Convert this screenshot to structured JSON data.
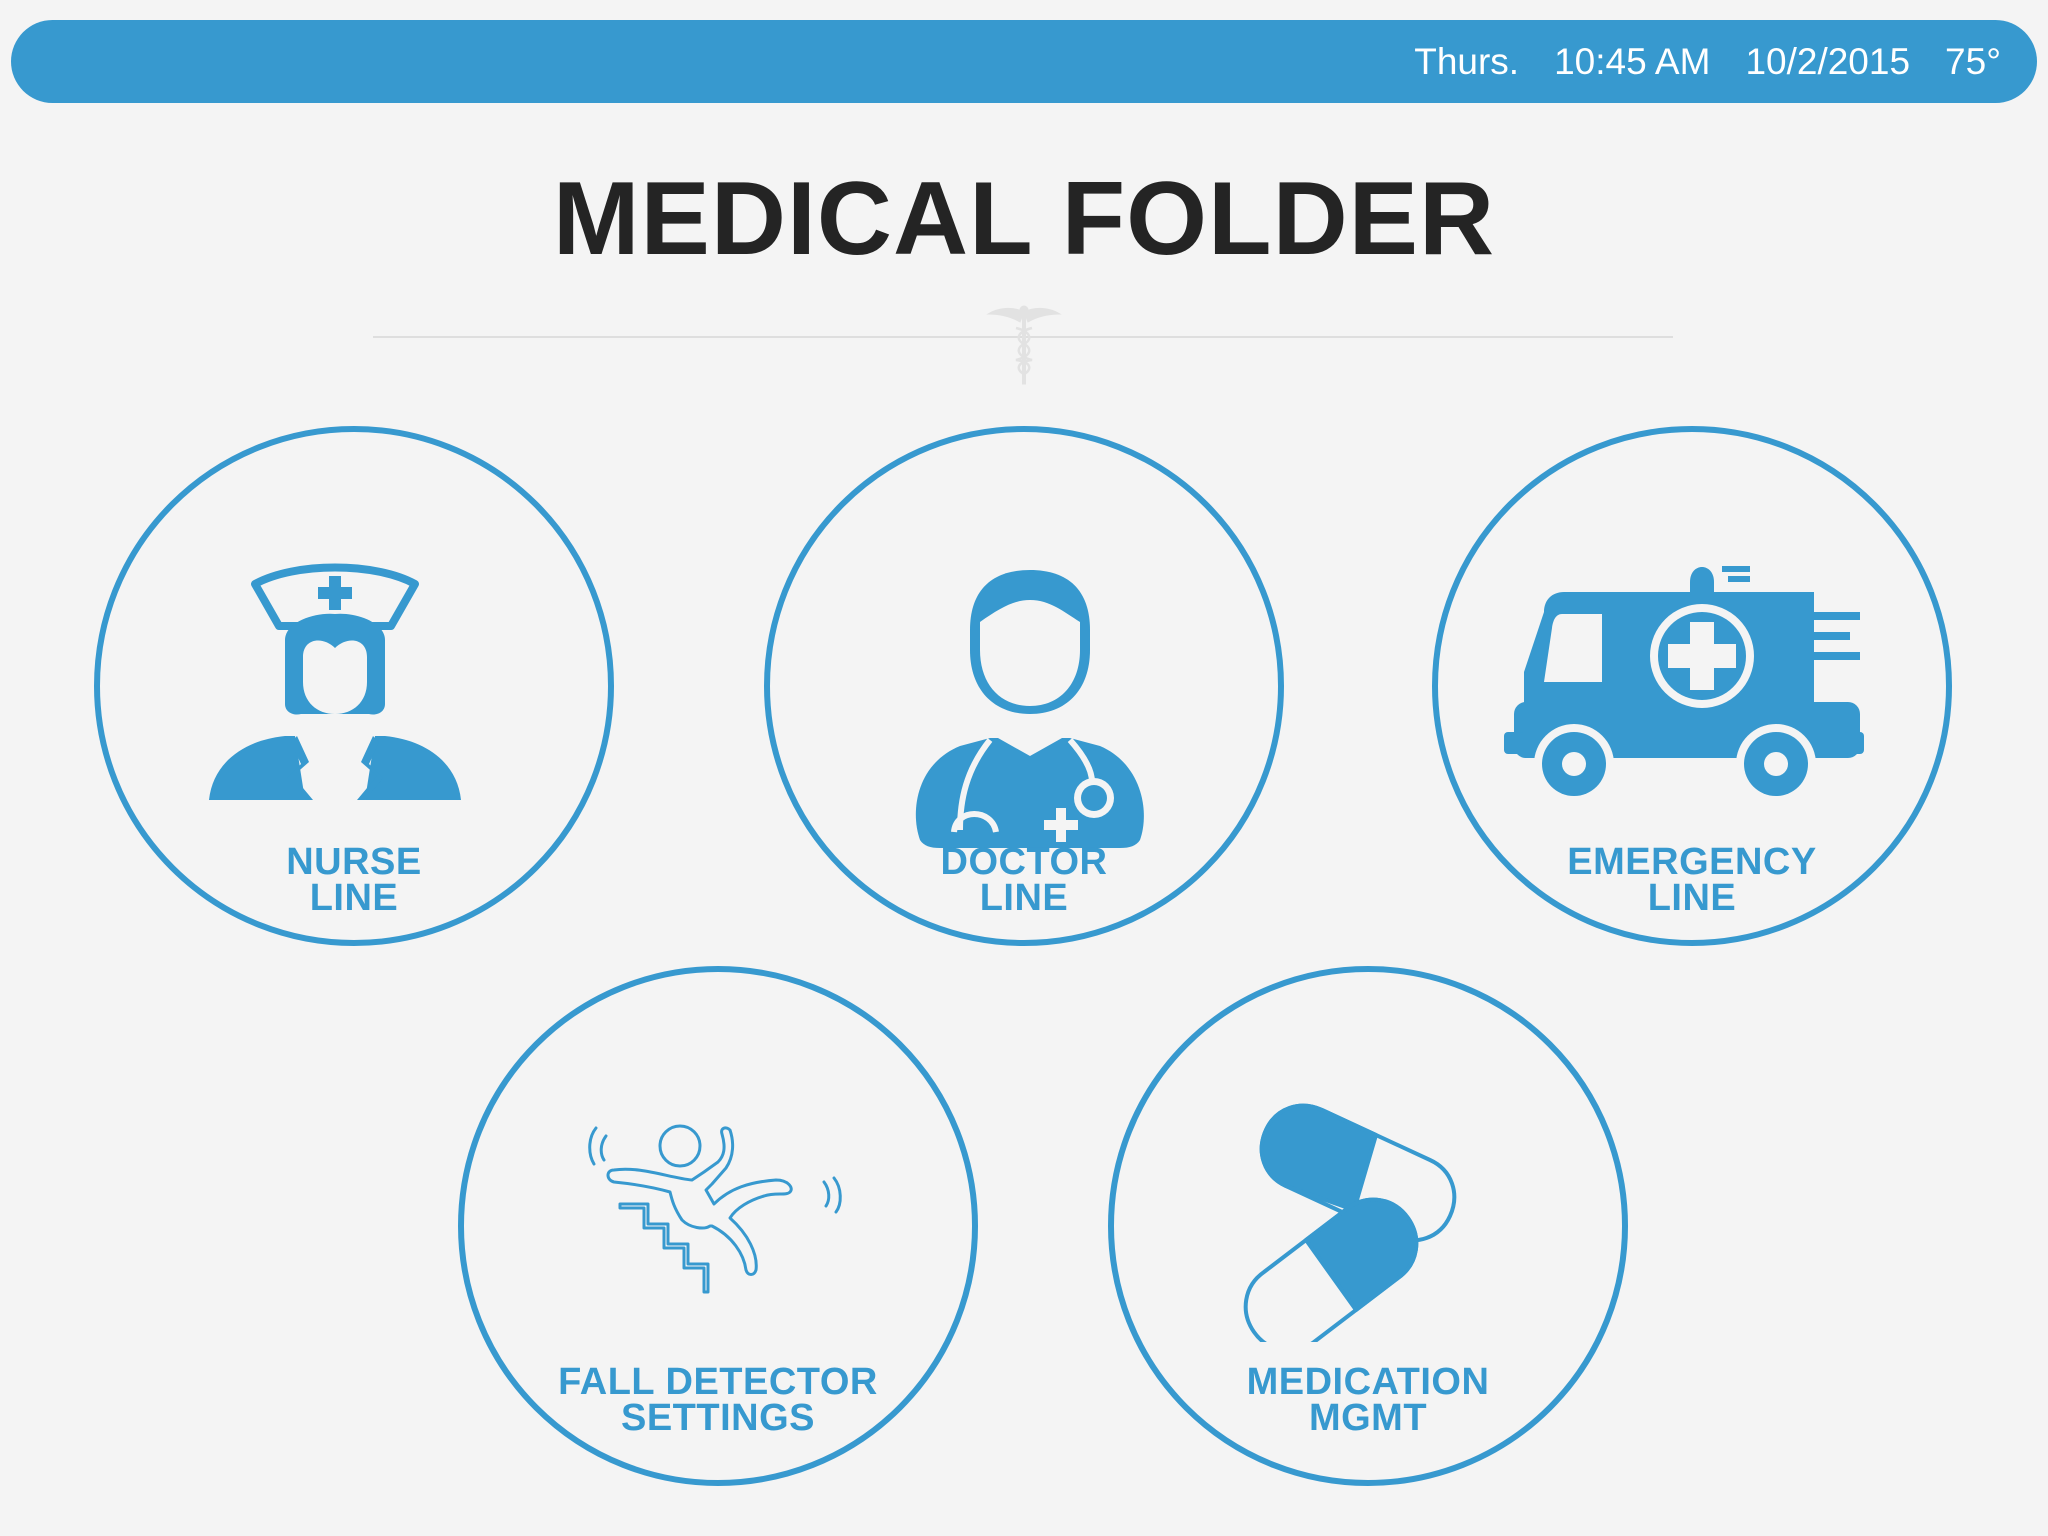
{
  "status_bar": {
    "day": "Thurs.",
    "time": "10:45 AM",
    "date": "10/2/2015",
    "temperature": "75°"
  },
  "page": {
    "title": "MEDICAL FOLDER",
    "divider_icon": "caduceus-icon"
  },
  "tiles": [
    {
      "icon": "nurse-icon",
      "line1": "NURSE",
      "line2": "LINE"
    },
    {
      "icon": "doctor-icon",
      "line1": "DOCTOR",
      "line2": "LINE"
    },
    {
      "icon": "ambulance-icon",
      "line1": "EMERGENCY",
      "line2": "LINE"
    },
    {
      "icon": "fall-detector-icon",
      "line1": "FALL DETECTOR",
      "line2": "SETTINGS"
    },
    {
      "icon": "pills-icon",
      "line1": "MEDICATION",
      "line2": "MGMT"
    }
  ],
  "colors": {
    "accent": "#3799cf",
    "background": "#f4f4f4",
    "title": "#242424",
    "status_text": "#ffffff"
  }
}
